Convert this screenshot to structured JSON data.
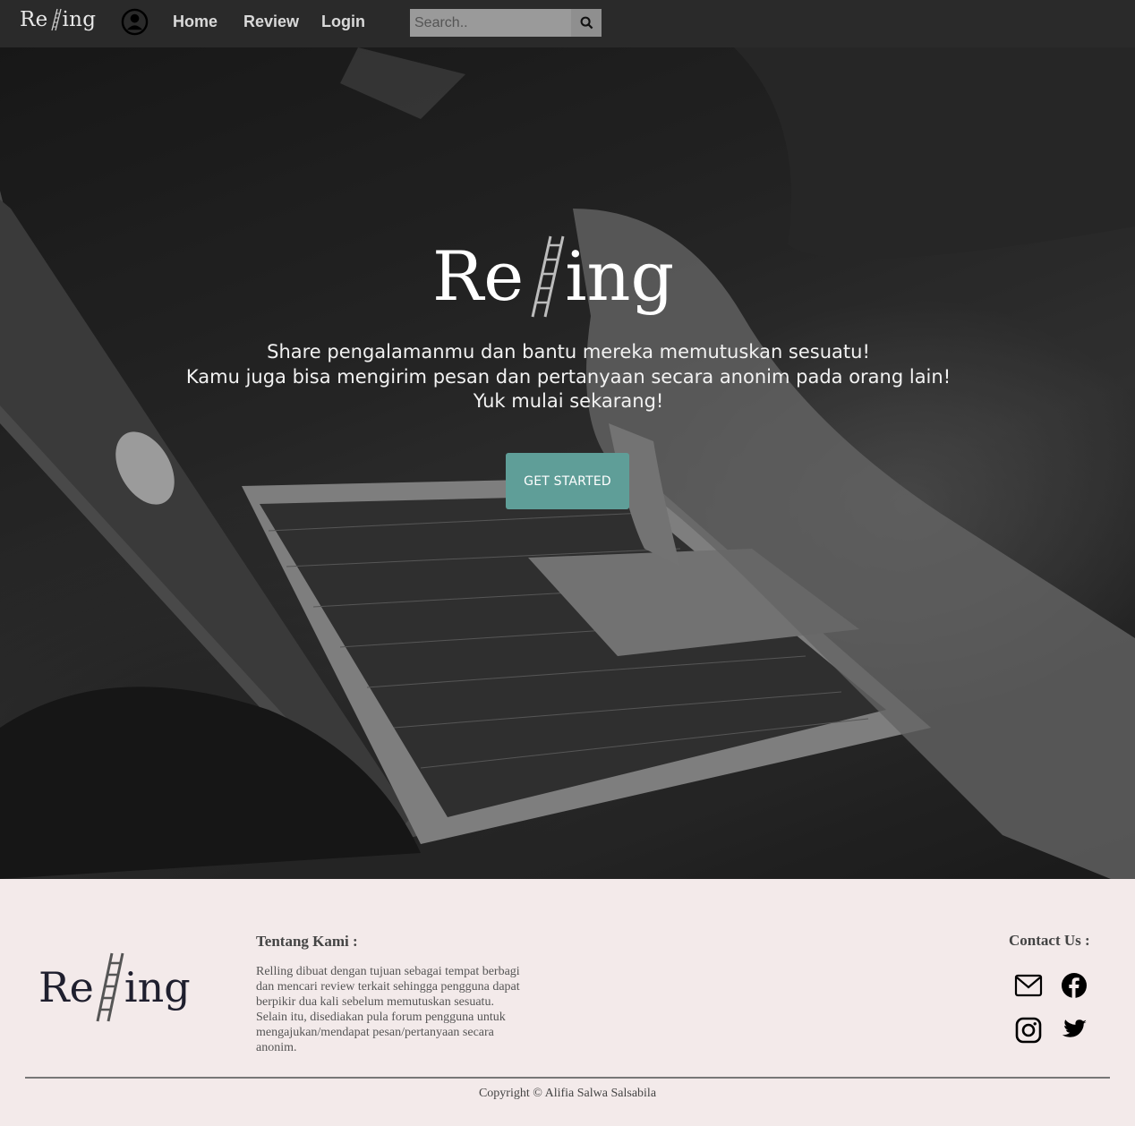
{
  "navbar": {
    "brand_left": "Re",
    "brand_right": "ing",
    "links": {
      "home": "Home",
      "review": "Review",
      "login": "Login"
    },
    "search": {
      "placeholder": "Search..",
      "value": ""
    },
    "icons": {
      "profile": "user-circle-icon",
      "search": "search-icon"
    }
  },
  "hero": {
    "logo_left": "Re",
    "logo_right": "ing",
    "lines": [
      "Share pengalamanmu dan bantu mereka memutuskan sesuatu!",
      "Kamu juga bisa mengirim pesan dan pertanyaan secara anonim pada orang lain!",
      "Yuk mulai sekarang!"
    ],
    "cta_label": "GET STARTED"
  },
  "footer": {
    "logo_left": "Re",
    "logo_right": "ing",
    "about_title": "Tentang Kami :",
    "about_text": "Relling dibuat dengan tujuan sebagai tempat berbagi dan mencari review terkait sehingga pengguna dapat berpikir dua kali sebelum memutuskan sesuatu. Selain itu, disediakan pula forum pengguna untuk mengajukan/mendapat pesan/pertanyaan secara anonim.",
    "contact_title": "Contact Us :",
    "social_icons": [
      "mail-icon",
      "facebook-icon",
      "instagram-icon",
      "twitter-icon"
    ],
    "copyright": "Copyright © Alifia Salwa Salsabila"
  },
  "colors": {
    "navbar_bg": "#2a2a2a",
    "cta_bg": "#5f9e98",
    "footer_bg": "#f3eaea",
    "footer_logo": "#1f1f2e"
  }
}
